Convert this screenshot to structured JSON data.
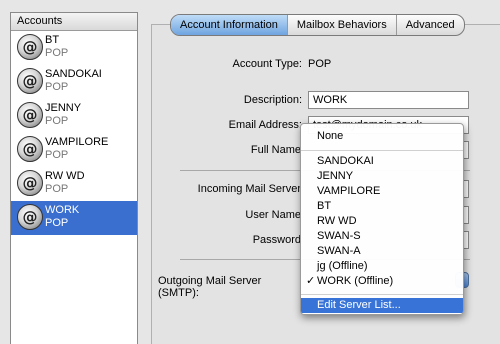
{
  "sidebar": {
    "header": "Accounts",
    "accounts": [
      {
        "name": "BT",
        "type": "POP"
      },
      {
        "name": "SANDOKAI",
        "type": "POP"
      },
      {
        "name": "JENNY",
        "type": "POP"
      },
      {
        "name": "VAMPILORE",
        "type": "POP"
      },
      {
        "name": "RW WD",
        "type": "POP"
      },
      {
        "name": "WORK",
        "type": "POP"
      }
    ]
  },
  "tabs": [
    "Account Information",
    "Mailbox Behaviors",
    "Advanced"
  ],
  "form": {
    "account_type_label": "Account Type:",
    "account_type_value": "POP",
    "description_label": "Description:",
    "description_value": "WORK",
    "email_label": "Email Address:",
    "email_value": "test@mydomain.co.uk",
    "full_name_label": "Full Name",
    "incoming_label": "Incoming Mail Server",
    "user_name_label": "User Name",
    "password_label": "Password",
    "smtp_label": "Outgoing Mail Server (SMTP):"
  },
  "menu": {
    "none": "None",
    "items": [
      "SANDOKAI",
      "JENNY",
      "VAMPILORE",
      "BT",
      "RW WD",
      "SWAN-S",
      "SWAN-A",
      "jg (Offline)",
      "WORK (Offline)"
    ],
    "checked": "✓",
    "edit": "Edit Server List..."
  },
  "colors": {
    "selection": "#3b6fcf",
    "menu_highlight": "#3874d8"
  }
}
